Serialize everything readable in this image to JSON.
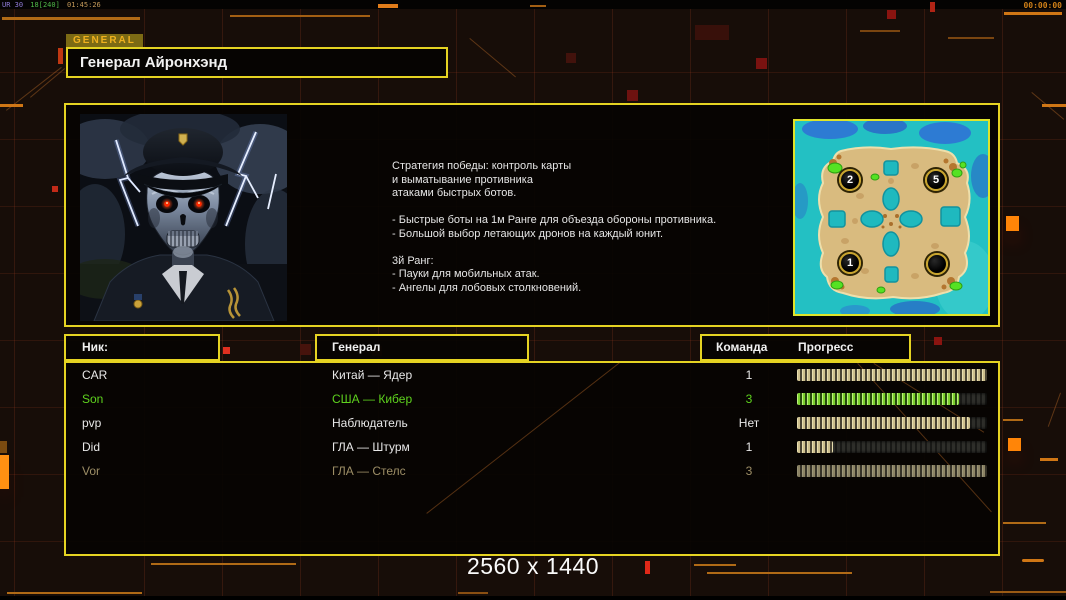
{
  "hud": {
    "debug": {
      "p1": "UR 30",
      "p2": "18[240]",
      "p3": "01:45:26"
    },
    "timer": "00:00:00",
    "resolution_label": "2560 x 1440"
  },
  "header": {
    "tab_label": "GENERAL",
    "general_name": "Генерал Айронхэнд"
  },
  "info": {
    "strategy_text": "Стратегия победы: контроль карты\nи выматывание противника\nатаками быстрых ботов.\n\n- Быстрые боты на 1м Ранге для объезда обороны противника.\n- Большой выбор летающих дронов на каждый юнит.\n\n3й Ранг:\n- Пауки для мобильных атак.\n- Ангелы для лобовых столкновений."
  },
  "map": {
    "start_points": [
      {
        "label": "2"
      },
      {
        "label": "5"
      },
      {
        "label": "1"
      },
      {
        "label": ""
      }
    ]
  },
  "players": {
    "headers": {
      "nick": "Ник:",
      "general": "Генерал",
      "team": "Команда",
      "progress": "Прогресс"
    },
    "rows": [
      {
        "nick": "CAR",
        "general": "Китай — Ядер",
        "team": "1",
        "progress": 100,
        "state": "normal"
      },
      {
        "nick": "Son",
        "general": "США — Кибер",
        "team": "3",
        "progress": 85,
        "state": "self"
      },
      {
        "nick": "pvp",
        "general": "Наблюдатель",
        "team": "Нет",
        "progress": 91,
        "state": "normal"
      },
      {
        "nick": "Did",
        "general": "ГЛА — Штурм",
        "team": "1",
        "progress": 19,
        "state": "normal"
      },
      {
        "nick": "Vor",
        "general": "ГЛА — Стелс",
        "team": "3",
        "progress": 100,
        "state": "dim"
      }
    ]
  },
  "colors": {
    "accent_yellow": "#e5d322",
    "self_green": "#5ed21e",
    "dim_text": "#9d8e66",
    "bar_beige": "#cec08e",
    "bar_green": "#7cd22e",
    "decor_orange": "#cf7615"
  }
}
